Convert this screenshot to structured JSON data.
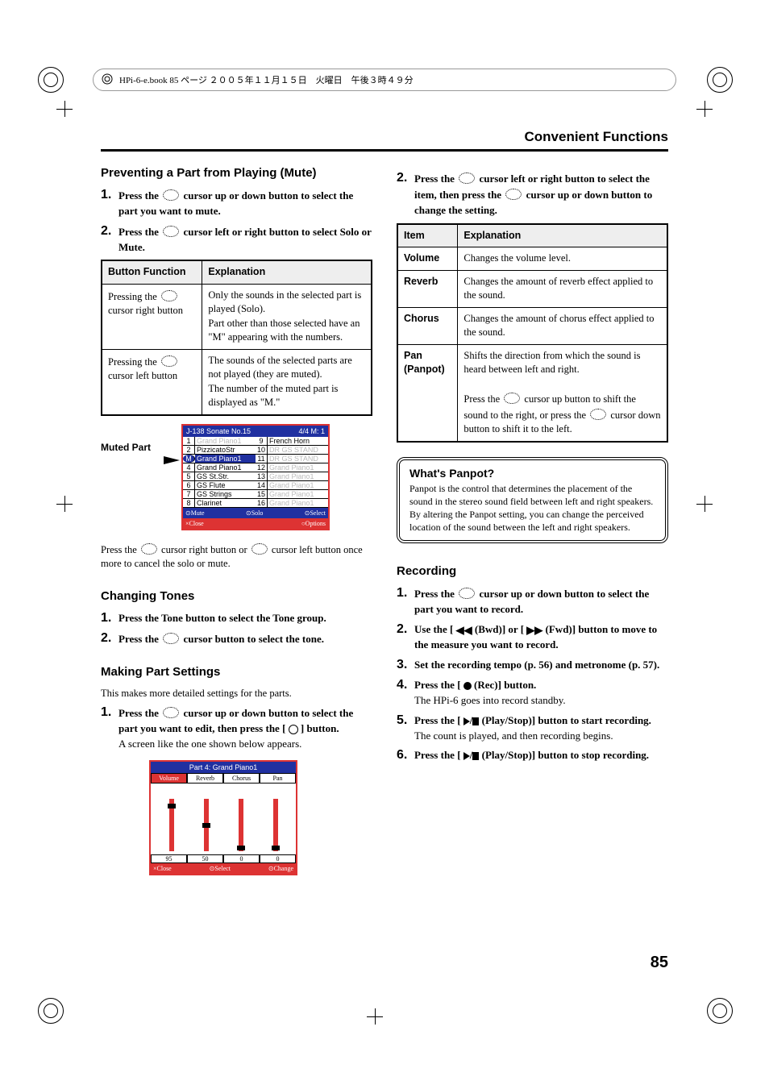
{
  "header": {
    "text": "HPi-6-e.book 85 ページ ２００５年１１月１５日　火曜日　午後３時４９分"
  },
  "running_head": "Convenient Functions",
  "page_number": "85",
  "left": {
    "mute": {
      "title": "Preventing a Part from Playing (Mute)",
      "steps": [
        "Press the  cursor up or down button to select the part you want to mute.",
        "Press the  cursor left or right button to select Solo or Mute."
      ],
      "table": {
        "head": [
          "Button Function",
          "Explanation"
        ],
        "rows": [
          {
            "a": "Pressing the  cursor right button",
            "b": "Only the sounds in the selected part is played (Solo).\nPart other than those selected have an \"M\" appearing with the numbers."
          },
          {
            "a": "Pressing the  cursor left button",
            "b": "The sounds of the selected parts are not played (they are muted).\nThe number of the muted part is displayed as \"M.\""
          }
        ]
      },
      "muted_label": "Muted Part",
      "shot": {
        "title_l": "J-138 Sonate No.15",
        "title_r": "4/4 M:   1",
        "left_parts": [
          {
            "n": "1",
            "name": "Grand Piano1",
            "dim": true
          },
          {
            "n": "2",
            "name": "PizzicatoStr"
          },
          {
            "n": "M",
            "name": "Grand Piano1",
            "selected": true,
            "muted": true
          },
          {
            "n": "4",
            "name": "Grand Piano1"
          },
          {
            "n": "5",
            "name": "GS St.Str."
          },
          {
            "n": "6",
            "name": "GS Flute"
          },
          {
            "n": "7",
            "name": "GS Strings"
          },
          {
            "n": "8",
            "name": "Clarinet"
          }
        ],
        "right_parts": [
          {
            "n": "9",
            "name": "French Horn"
          },
          {
            "n": "10",
            "name": "DR GS STAND",
            "dim": true
          },
          {
            "n": "11",
            "name": "DR GS STAND",
            "dim": true
          },
          {
            "n": "12",
            "name": "Grand Piano1",
            "dim": true
          },
          {
            "n": "13",
            "name": "Grand Piano1",
            "dim": true
          },
          {
            "n": "14",
            "name": "Grand Piano1",
            "dim": true
          },
          {
            "n": "15",
            "name": "Grand Piano1",
            "dim": true
          },
          {
            "n": "16",
            "name": "Grand Piano1",
            "dim": true
          }
        ],
        "foot": [
          "⊙Mute",
          "⊙Solo",
          "⊙Select"
        ],
        "bot": [
          "×Close",
          "○Options"
        ]
      },
      "cancel_note": "Press the  cursor right button or  cursor left button once more to cancel the solo or mute."
    },
    "tones": {
      "title": "Changing Tones",
      "steps": [
        "Press the Tone button to select the Tone group.",
        "Press the  cursor button to select the tone."
      ]
    },
    "part_settings": {
      "title": "Making Part Settings",
      "intro": "This makes more detailed settings for the parts.",
      "step1_a": "Press the  cursor up or down button to select the part you want to edit, then press the [",
      "step1_b": "] button.",
      "step1_note": "A screen like the one shown below appears.",
      "shot": {
        "title": "Part 4: Grand Piano1",
        "tabs": [
          "Volume",
          "Reverb",
          "Chorus",
          "Pan"
        ],
        "vals": [
          "95",
          "50",
          "0",
          "0"
        ],
        "foot_l": "×Close",
        "foot_m": "⊙Select",
        "foot_r": "⊙Change"
      }
    }
  },
  "right": {
    "step2": "Press the  cursor left or right button to select the item, then press the  cursor up or down button to change the setting.",
    "table": {
      "head": [
        "Item",
        "Explanation"
      ],
      "rows": [
        {
          "a": "Volume",
          "b": "Changes the volume level."
        },
        {
          "a": "Reverb",
          "b": "Changes the amount of reverb effect applied to the sound."
        },
        {
          "a": "Chorus",
          "b": "Changes the amount of chorus effect applied to the sound."
        },
        {
          "a": "Pan (Panpot)",
          "b_lines": [
            "Shifts the direction from which the sound is heard between left and right.",
            "Press the  cursor up button to shift the sound to the right, or press the  cursor down button to shift it to the left."
          ]
        }
      ]
    },
    "panpot": {
      "title": "What's Panpot?",
      "body": "Panpot is the control that determines the placement of the sound in the stereo sound field between left and right speakers. By altering the Panpot setting, you can change the perceived location of the sound between the left and right speakers."
    },
    "recording": {
      "title": "Recording",
      "s1": "Press the  cursor up or down button to select the part you want to record.",
      "s2": "Use the [  (Bwd)] or [  (Fwd)] button to move to the measure you want to record.",
      "s3": "Set the recording tempo (p. 56) and metronome (p. 57).",
      "s4_a": "Press the [",
      "s4_b": "(Rec)] button.",
      "s4_note": "The HPi-6 goes into record standby.",
      "s5_a": "Press the [",
      "s5_b": "(Play/Stop)] button to start recording.",
      "s5_note": "The count is played, and then recording begins.",
      "s6_a": "Press the [",
      "s6_b": "(Play/Stop)] button to stop recording."
    }
  }
}
